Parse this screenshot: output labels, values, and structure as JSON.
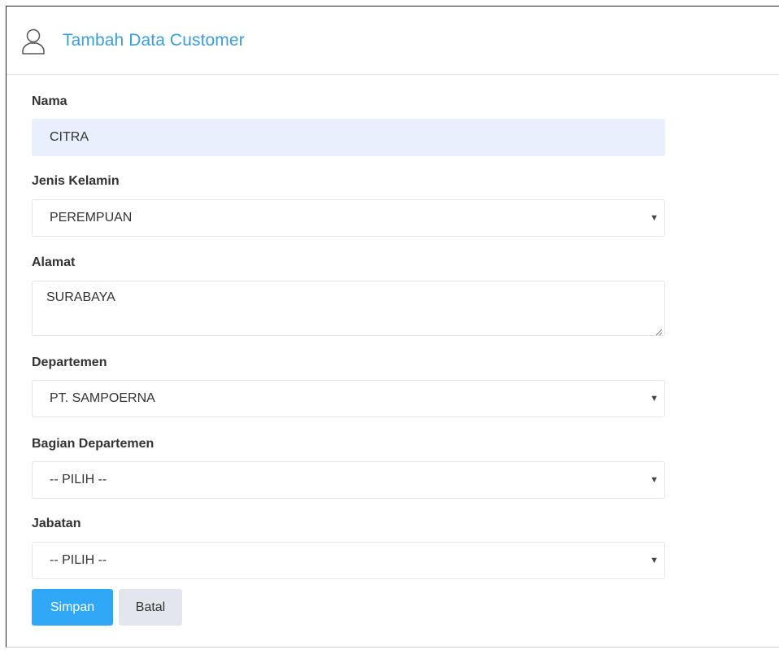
{
  "header": {
    "icon": "user-icon",
    "title": "Tambah Data Customer",
    "title_color": "#3a9ee3"
  },
  "form": {
    "nama": {
      "label": "Nama",
      "value": "CITRA"
    },
    "jenis_kelamin": {
      "label": "Jenis Kelamin",
      "value": "PEREMPUAN"
    },
    "alamat": {
      "label": "Alamat",
      "value": "SURABAYA"
    },
    "departemen": {
      "label": "Departemen",
      "value": "PT. SAMPOERNA"
    },
    "bagian_departemen": {
      "label": "Bagian Departemen",
      "value": "-- PILIH --"
    },
    "jabatan": {
      "label": "Jabatan",
      "value": "-- PILIH --"
    }
  },
  "buttons": {
    "save_label": "Simpan",
    "cancel_label": "Batal",
    "primary_color": "#31a8f7"
  },
  "icons": {
    "dropdown": "chevron-down-icon",
    "resize": "resize-grip-icon"
  }
}
